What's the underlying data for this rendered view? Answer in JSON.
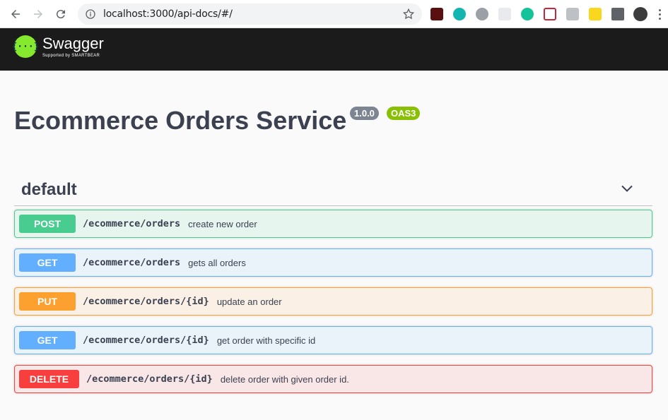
{
  "browser": {
    "url": "localhost:3000/api-docs/#/"
  },
  "swagger": {
    "brand": "Swagger",
    "sub": "Supported by SMARTBEAR",
    "logo_glyph": "{···}"
  },
  "info": {
    "title": "Ecommerce Orders Service",
    "version": "1.0.0",
    "oas": "OAS3"
  },
  "section": {
    "name": "default"
  },
  "operations": [
    {
      "method": "POST",
      "path": "/ecommerce/orders",
      "summary": "create new order",
      "color": "#49cc90"
    },
    {
      "method": "GET",
      "path": "/ecommerce/orders",
      "summary": "gets all orders",
      "color": "#61affe"
    },
    {
      "method": "PUT",
      "path": "/ecommerce/orders/{id}",
      "summary": "update an order",
      "color": "#fca130"
    },
    {
      "method": "GET",
      "path": "/ecommerce/orders/{id}",
      "summary": "get order with specific id",
      "color": "#61affe"
    },
    {
      "method": "DELETE",
      "path": "/ecommerce/orders/{id}",
      "summary": "delete order with given order id.",
      "color": "#f93e3e"
    }
  ],
  "icons": [
    "back-icon",
    "forward-icon",
    "reload-icon",
    "info-icon",
    "star-icon",
    "chevron-down-icon"
  ]
}
